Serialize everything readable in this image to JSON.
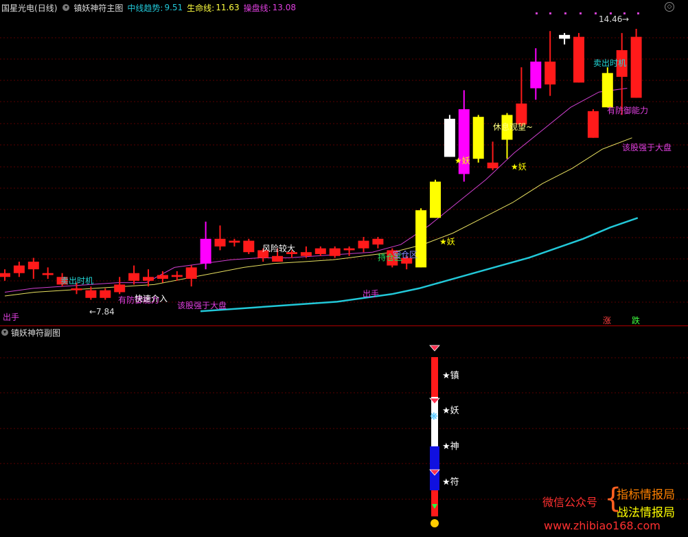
{
  "header": {
    "stock_name": "国星光电",
    "period": "(日线)",
    "indicator_name": "镇妖神符主图",
    "mid_trend_label": "中线趋势:",
    "mid_trend_value": "9.51",
    "life_line_label": "生命线:",
    "life_line_value": "11.63",
    "trade_line_label": "操盘线:",
    "trade_line_value": "13.08"
  },
  "sub_panel": {
    "title": "镇妖神符副图",
    "labels": [
      "★镇",
      "★妖",
      "★神",
      "★符"
    ]
  },
  "annotations": {
    "high_price": "14.46",
    "low_price": "←7.84",
    "sell_time_1": "卖出时机",
    "sell_time_2": "卖出时机",
    "fast_entry": "快速介入",
    "defense_1": "有防御能力",
    "defense_2": "有防御能力",
    "stronger_1": "该股强于大盘",
    "stronger_2": "该股强于大盘",
    "risk": "风险较大",
    "hold": "持仓区",
    "empty": "空仓区",
    "out_1": "出手",
    "out_2": "出手",
    "rest": "休息观望~",
    "yao": "★妖",
    "rise": "涨",
    "fall": "跌"
  },
  "watermark": {
    "wechat": "微信公众号",
    "brand1": "指标情报局",
    "brand2": "战法情报局",
    "url": "www.zhibiao168.com"
  },
  "colors": {
    "up": "#ff1a1a",
    "magenta": "#ff00ff",
    "yellow": "#ffff00",
    "cyan": "#22c8d8",
    "ma_yellow": "#e8e060",
    "ma_magenta": "#d040d0"
  },
  "chart_data": {
    "type": "candlestick",
    "candles": [
      {
        "o": 7.95,
        "c": 8.05,
        "h": 8.15,
        "l": 7.85,
        "col": "red"
      },
      {
        "o": 8.05,
        "c": 8.25,
        "h": 8.35,
        "l": 7.95,
        "col": "red"
      },
      {
        "o": 8.15,
        "c": 8.35,
        "h": 8.45,
        "l": 7.9,
        "col": "red"
      },
      {
        "o": 8.0,
        "c": 8.05,
        "h": 8.2,
        "l": 7.9,
        "col": "red"
      },
      {
        "o": 7.75,
        "c": 7.95,
        "h": 8.05,
        "l": 7.7,
        "col": "red"
      },
      {
        "o": 7.6,
        "c": 7.65,
        "h": 7.8,
        "l": 7.5,
        "col": "red"
      },
      {
        "o": 7.4,
        "c": 7.6,
        "h": 7.7,
        "l": 7.35,
        "col": "red"
      },
      {
        "o": 7.4,
        "c": 7.6,
        "h": 7.65,
        "l": 7.35,
        "col": "red"
      },
      {
        "o": 7.75,
        "c": 7.55,
        "h": 7.95,
        "l": 7.5,
        "col": "red"
      },
      {
        "o": 7.85,
        "c": 8.05,
        "h": 8.25,
        "l": 7.75,
        "col": "red"
      },
      {
        "o": 7.85,
        "c": 7.95,
        "h": 8.15,
        "l": 7.7,
        "col": "red"
      },
      {
        "o": 7.9,
        "c": 8.0,
        "h": 8.1,
        "l": 7.8,
        "col": "red"
      },
      {
        "o": 7.95,
        "c": 8.0,
        "h": 8.1,
        "l": 7.85,
        "col": "red"
      },
      {
        "o": 8.2,
        "c": 7.9,
        "h": 8.25,
        "l": 7.7,
        "col": "red"
      },
      {
        "o": 8.3,
        "c": 8.95,
        "h": 9.4,
        "l": 8.15,
        "col": "magenta"
      },
      {
        "o": 8.95,
        "c": 8.75,
        "h": 9.3,
        "l": 8.65,
        "col": "red"
      },
      {
        "o": 8.9,
        "c": 8.85,
        "h": 8.95,
        "l": 8.75,
        "col": "red"
      },
      {
        "o": 8.9,
        "c": 8.6,
        "h": 8.95,
        "l": 8.55,
        "col": "red"
      },
      {
        "o": 8.65,
        "c": 8.45,
        "h": 8.7,
        "l": 8.35,
        "col": "red"
      },
      {
        "o": 8.35,
        "c": 8.5,
        "h": 8.7,
        "l": 8.35,
        "col": "red"
      },
      {
        "o": 8.55,
        "c": 8.6,
        "h": 8.65,
        "l": 8.45,
        "col": "red"
      },
      {
        "o": 8.5,
        "c": 8.6,
        "h": 8.75,
        "l": 8.45,
        "col": "red"
      },
      {
        "o": 8.7,
        "c": 8.55,
        "h": 8.75,
        "l": 8.5,
        "col": "red"
      },
      {
        "o": 8.7,
        "c": 8.5,
        "h": 8.75,
        "l": 8.45,
        "col": "red"
      },
      {
        "o": 8.65,
        "c": 8.7,
        "h": 8.75,
        "l": 8.5,
        "col": "red"
      },
      {
        "o": 8.9,
        "c": 8.7,
        "h": 9.0,
        "l": 8.6,
        "col": "red"
      },
      {
        "o": 8.95,
        "c": 8.8,
        "h": 9.0,
        "l": 8.7,
        "col": "red"
      },
      {
        "o": 8.65,
        "c": 8.25,
        "h": 8.7,
        "l": 8.2,
        "col": "red"
      },
      {
        "o": 8.45,
        "c": 8.3,
        "h": 8.5,
        "l": 8.15,
        "col": "red"
      },
      {
        "o": 8.2,
        "c": 9.7,
        "h": 9.75,
        "l": 8.2,
        "col": "yellow"
      },
      {
        "o": 9.5,
        "c": 10.45,
        "h": 10.5,
        "l": 9.5,
        "col": "yellow"
      },
      {
        "o": 11.1,
        "c": 12.1,
        "h": 12.2,
        "l": 11.1,
        "col": "white"
      },
      {
        "o": 10.65,
        "c": 12.35,
        "h": 12.85,
        "l": 10.45,
        "col": "magenta"
      },
      {
        "o": 12.15,
        "c": 11.05,
        "h": 12.2,
        "l": 10.95,
        "col": "yellow"
      },
      {
        "o": 10.95,
        "c": 10.8,
        "h": 11.5,
        "l": 10.75,
        "col": "red"
      },
      {
        "o": 11.55,
        "c": 12.2,
        "h": 12.25,
        "l": 11.05,
        "col": "yellow"
      },
      {
        "o": 12.5,
        "c": 11.95,
        "h": 13.45,
        "l": 11.9,
        "col": "red"
      },
      {
        "o": 13.6,
        "c": 12.9,
        "h": 13.95,
        "l": 12.6,
        "col": "magenta"
      },
      {
        "o": 13.0,
        "c": 13.6,
        "h": 14.4,
        "l": 12.7,
        "col": "red"
      },
      {
        "o": 14.3,
        "c": 14.2,
        "h": 14.35,
        "l": 14.05,
        "col": "white"
      },
      {
        "o": 14.25,
        "c": 13.05,
        "h": 14.35,
        "l": 13.05,
        "col": "red"
      },
      {
        "o": 12.3,
        "c": 11.6,
        "h": 12.35,
        "l": 11.6,
        "col": "red"
      },
      {
        "o": 12.4,
        "c": 13.3,
        "h": 13.45,
        "l": 12.4,
        "col": "yellow"
      },
      {
        "o": 13.9,
        "c": 13.2,
        "h": 14.35,
        "l": 12.2,
        "col": "red"
      },
      {
        "o": 14.25,
        "c": 12.65,
        "h": 14.46,
        "l": 12.65,
        "col": "red"
      }
    ],
    "trend_line_cyan": [
      7.05,
      7.1,
      7.15,
      7.2,
      7.25,
      7.3,
      7.4,
      7.5,
      7.65,
      7.85,
      8.05,
      8.25,
      8.45,
      8.7,
      8.95,
      9.25,
      9.5
    ],
    "ma_yellow": [
      7.45,
      7.55,
      7.6,
      7.65,
      7.7,
      7.75,
      7.9,
      8.05,
      8.2,
      8.3,
      8.35,
      8.4,
      8.5,
      8.6,
      8.8,
      9.1,
      9.5,
      9.9,
      10.4,
      10.8,
      11.3,
      11.6
    ],
    "ma_magenta": [
      7.55,
      7.65,
      7.7,
      7.75,
      7.8,
      7.8,
      8.2,
      8.3,
      8.4,
      8.45,
      8.45,
      8.5,
      8.55,
      8.6,
      8.8,
      9.3,
      9.9,
      10.5,
      11.2,
      11.8,
      12.4,
      12.8,
      12.9
    ]
  }
}
